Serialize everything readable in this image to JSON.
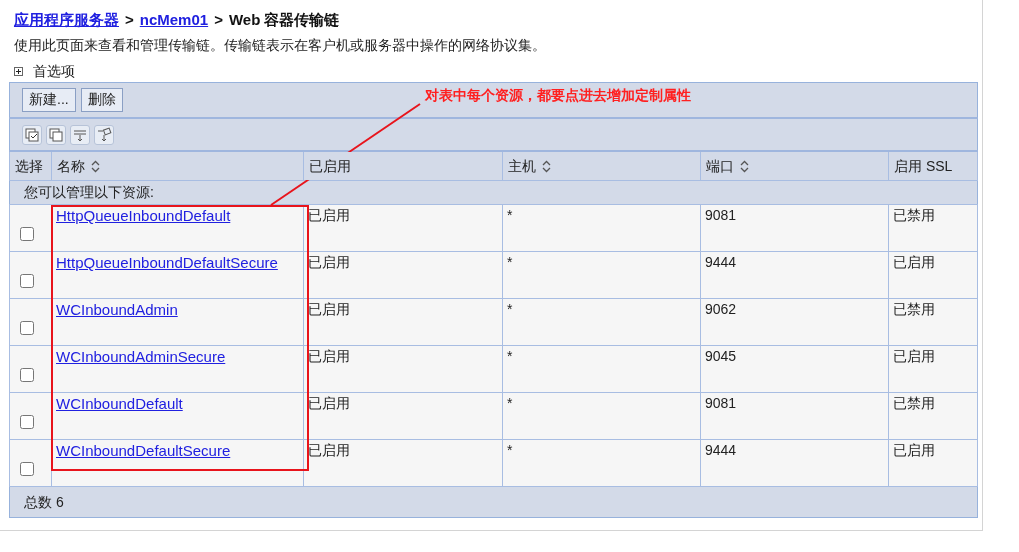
{
  "breadcrumb": [
    {
      "kind": "link",
      "label": "应用程序服务器"
    },
    {
      "kind": "separator",
      "label": ">"
    },
    {
      "kind": "link",
      "label": "ncMem01"
    },
    {
      "kind": "separator",
      "label": ">"
    },
    {
      "kind": "current",
      "label": "Web 容器传输链"
    }
  ],
  "description": "使用此页面来查看和管理传输链。传输链表示在客户机或服务器中操作的网络协议集。",
  "preferences": {
    "label": "首选项",
    "expanded": false
  },
  "buttons": [
    "新建...",
    "删除"
  ],
  "annotation": {
    "text": "对表中每个资源，都要点进去增加定制属性"
  },
  "table": {
    "columns": [
      {
        "label": "选择",
        "sortable": false
      },
      {
        "label": "名称",
        "sortable": true
      },
      {
        "label": "已启用",
        "sortable": false
      },
      {
        "label": "主机",
        "sortable": true
      },
      {
        "label": "端口",
        "sortable": true
      },
      {
        "label": "启用 SSL",
        "sortable": false
      }
    ],
    "caption": "您可以管理以下资源:",
    "rows": [
      {
        "checked": false,
        "name": "HttpQueueInboundDefault",
        "enabled": "已启用",
        "host": "*",
        "port": "9081",
        "ssl": "已禁用"
      },
      {
        "checked": false,
        "name": "HttpQueueInboundDefaultSecure",
        "enabled": "已启用",
        "host": "*",
        "port": "9444",
        "ssl": "已启用"
      },
      {
        "checked": false,
        "name": "WCInboundAdmin",
        "enabled": "已启用",
        "host": "*",
        "port": "9062",
        "ssl": "已禁用"
      },
      {
        "checked": false,
        "name": "WCInboundAdminSecure",
        "enabled": "已启用",
        "host": "*",
        "port": "9045",
        "ssl": "已启用"
      },
      {
        "checked": false,
        "name": "WCInboundDefault",
        "enabled": "已启用",
        "host": "*",
        "port": "9081",
        "ssl": "已禁用"
      },
      {
        "checked": false,
        "name": "WCInboundDefaultSecure",
        "enabled": "已启用",
        "host": "*",
        "port": "9444",
        "ssl": "已启用"
      }
    ],
    "total": "总数 6"
  }
}
